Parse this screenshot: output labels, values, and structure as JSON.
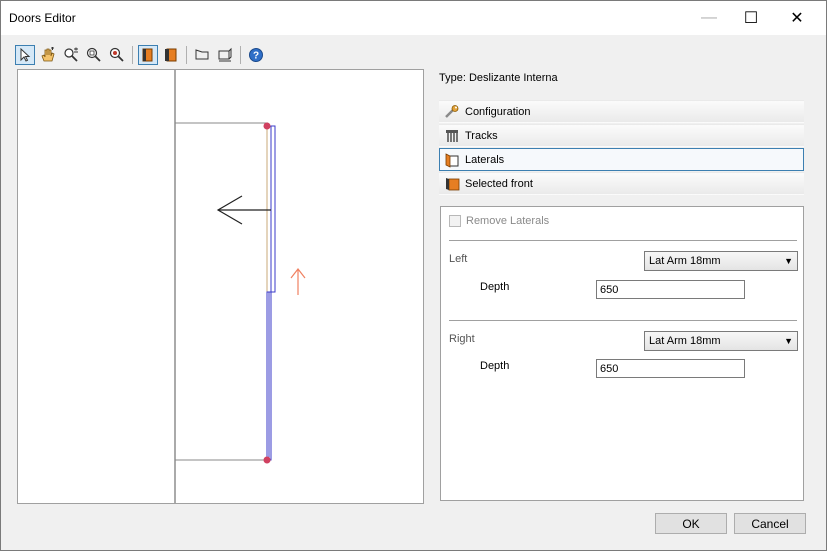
{
  "window": {
    "title": "Doors Editor",
    "minimize_glyph": "—",
    "maximize_glyph": "☐",
    "close_glyph": "✕"
  },
  "toolbar": {
    "items": [
      {
        "icon": "select-arrow-icon",
        "active": true
      },
      {
        "icon": "pan-hand-icon",
        "active": false
      },
      {
        "icon": "zoom-in-out-icon",
        "active": false
      },
      {
        "icon": "zoom-window-icon",
        "active": false
      },
      {
        "icon": "zoom-extents-icon",
        "active": false
      },
      {
        "icon": "door-view-front-icon",
        "active": true
      },
      {
        "icon": "door-view-side-icon",
        "active": false
      },
      {
        "icon": "perspective-left-icon",
        "active": false
      },
      {
        "icon": "perspective-right-icon",
        "active": false
      },
      {
        "icon": "help-icon",
        "active": false
      }
    ]
  },
  "properties": {
    "type_label": "Type: Deslizante Interna",
    "sections": {
      "configuration": "Configuration",
      "tracks": "Tracks",
      "laterals": "Laterals",
      "selected_front": "Selected front"
    },
    "selected_section": "laterals"
  },
  "laterals_panel": {
    "remove_laterals_label": "Remove Laterals",
    "remove_laterals_checked": false,
    "left": {
      "label": "Left",
      "profile_value": "Lat Arm 18mm",
      "depth_label": "Depth",
      "depth_value": "650"
    },
    "right": {
      "label": "Right",
      "profile_value": "Lat Arm 18mm",
      "depth_label": "Depth",
      "depth_value": "650"
    }
  },
  "buttons": {
    "ok": "OK",
    "cancel": "Cancel"
  },
  "colors": {
    "door_line": "#3a3ac8",
    "marker": "#d04060",
    "direction_arrow": "#f08060",
    "accent": "#3c7fb1"
  }
}
